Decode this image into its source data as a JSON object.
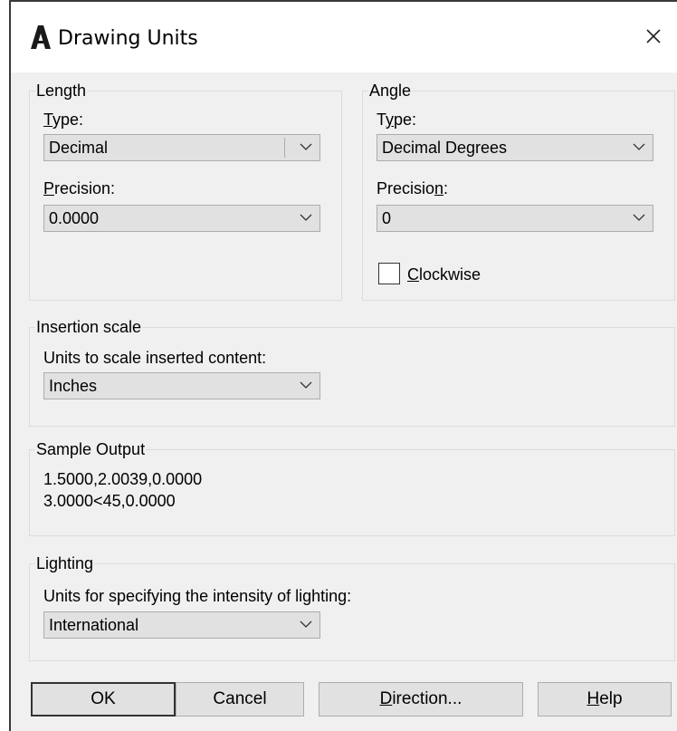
{
  "window": {
    "title": "Drawing Units",
    "icon": "autocad-a-icon",
    "close_icon": "close-icon"
  },
  "length": {
    "legend": "Length",
    "type_label": "Type:",
    "type_value": "Decimal",
    "precision_label": "Precision:",
    "precision_value": "0.0000"
  },
  "angle": {
    "legend": "Angle",
    "type_label": "Type:",
    "type_value": "Decimal Degrees",
    "precision_label": "Precision:",
    "precision_value": "0",
    "clockwise_label": "Clockwise",
    "clockwise_checked": false
  },
  "insertion": {
    "legend": "Insertion scale",
    "label": "Units to scale inserted content:",
    "value": "Inches"
  },
  "sample": {
    "legend": "Sample Output",
    "line1": "1.5000,2.0039,0.0000",
    "line2": "3.0000<45,0.0000"
  },
  "lighting": {
    "legend": "Lighting",
    "label": "Units for specifying the intensity of lighting:",
    "value": "International"
  },
  "buttons": {
    "ok": "OK",
    "cancel": "Cancel",
    "direction": "Direction...",
    "help": "Help"
  }
}
